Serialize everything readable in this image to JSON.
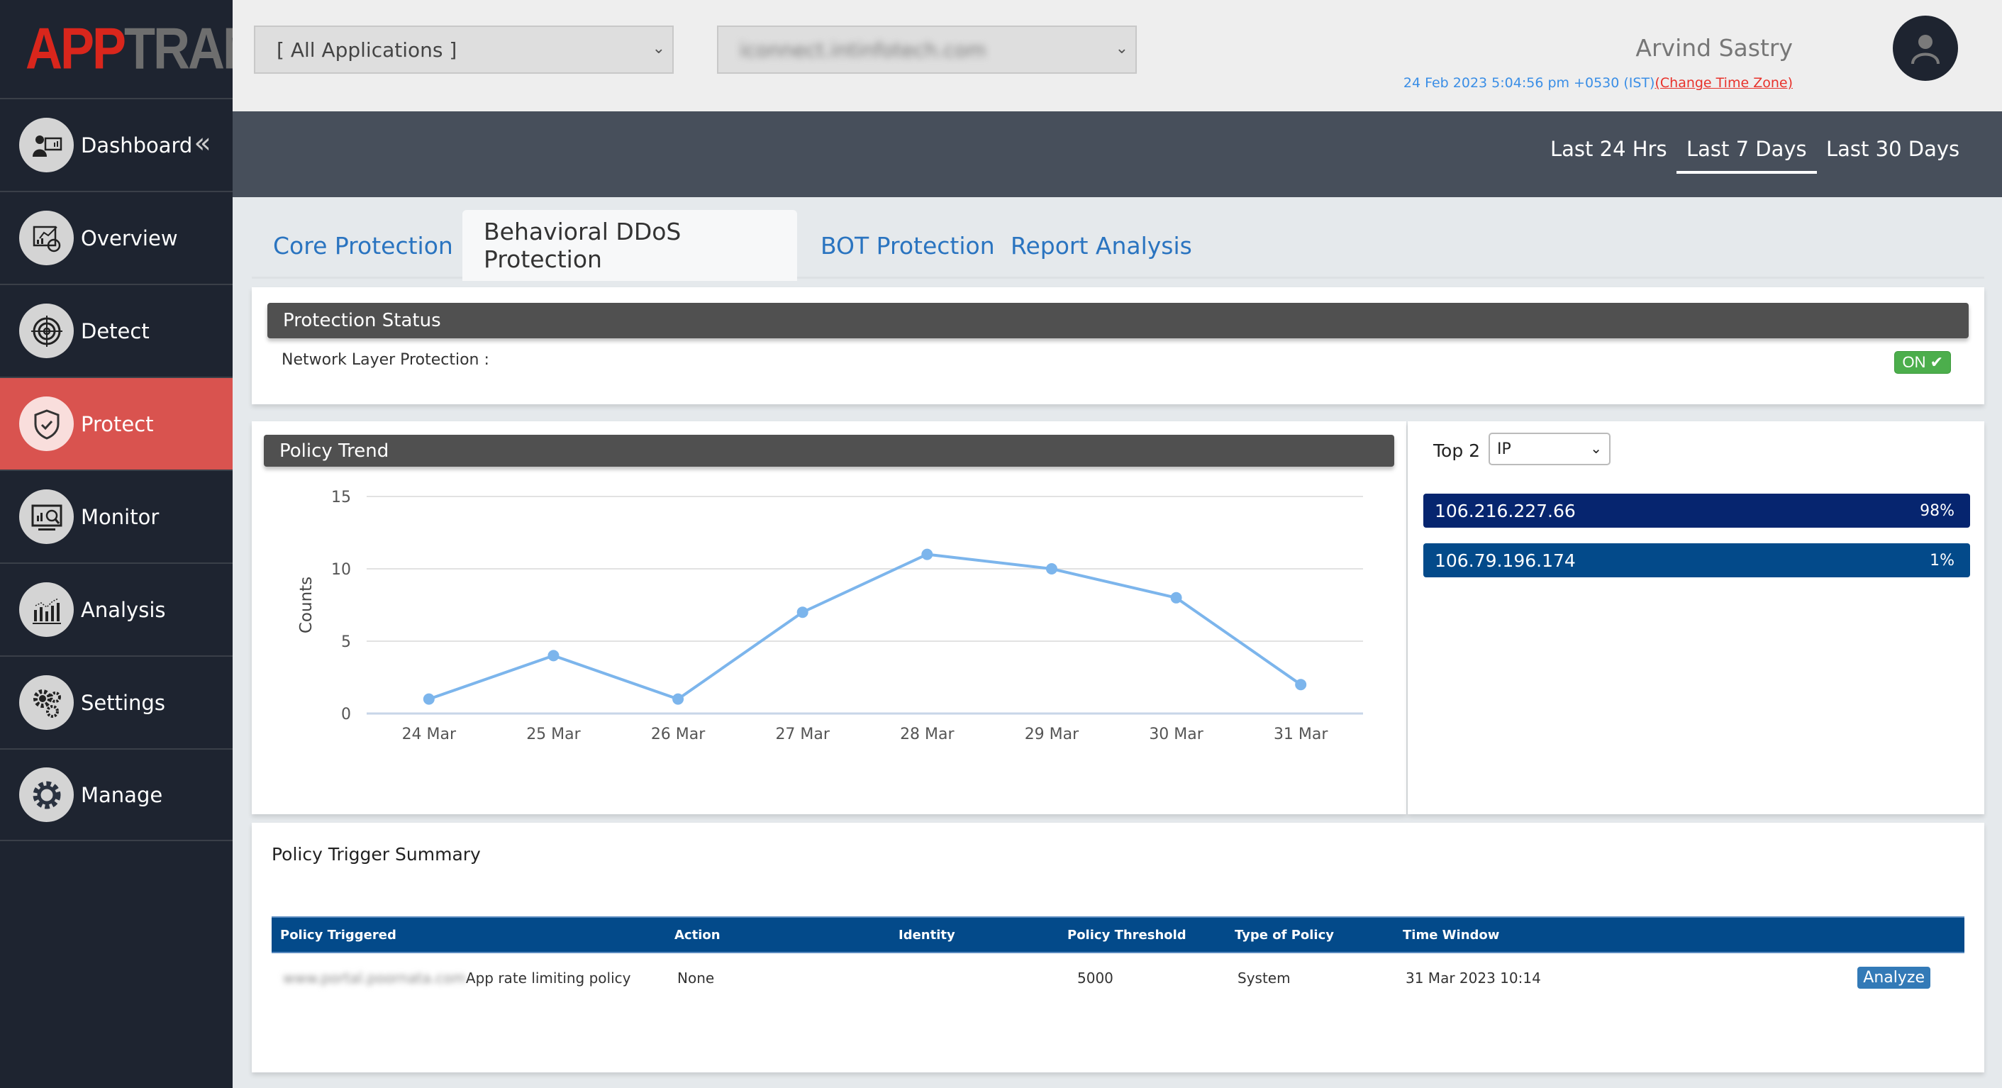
{
  "brand": {
    "part1": "APP",
    "part2": "TRANA"
  },
  "sidebar": {
    "collapse_icon": "«",
    "items": [
      {
        "label": "Dashboard",
        "icon": "dashboard-icon"
      },
      {
        "label": "Overview",
        "icon": "overview-icon"
      },
      {
        "label": "Detect",
        "icon": "target-icon"
      },
      {
        "label": "Protect",
        "icon": "shield-check-icon",
        "active": true
      },
      {
        "label": "Monitor",
        "icon": "monitor-icon"
      },
      {
        "label": "Analysis",
        "icon": "analysis-icon"
      },
      {
        "label": "Settings",
        "icon": "gears-icon"
      },
      {
        "label": "Manage",
        "icon": "gear-icon"
      }
    ]
  },
  "header": {
    "app_select": "[ All Applications ]",
    "domain_select": "iconnect.intinfotech.com",
    "user_name": "Arvind Sastry",
    "datetime": "24 Feb 2023 5:04:56 pm +0530 (IST)",
    "change_tz": "(Change Time Zone)"
  },
  "ranges": [
    "Last 24 Hrs",
    "Last 7 Days",
    "Last 30 Days"
  ],
  "active_range": "Last 7 Days",
  "tabs": [
    "Core Protection",
    "Behavioral DDoS Protection",
    "BOT Protection",
    "Report Analysis"
  ],
  "active_tab": "Behavioral DDoS Protection",
  "protection": {
    "title": "Protection Status",
    "label": "Network Layer Protection :",
    "status": "ON ✔"
  },
  "trend": {
    "title": "Policy Trend"
  },
  "top": {
    "label": "Top 2",
    "select": "IP",
    "items": [
      {
        "ip": "106.216.227.66",
        "pct": "98%",
        "color": "#06256f"
      },
      {
        "ip": "106.79.196.174",
        "pct": "1%",
        "color": "#034a8a"
      }
    ]
  },
  "summary": {
    "title": "Policy Trigger Summary",
    "columns": [
      "Policy Triggered",
      "Action",
      "Identity",
      "Policy Threshold",
      "Type of Policy",
      "Time Window",
      ""
    ],
    "rows": [
      {
        "domain": "www.portal.poornata.com",
        "policy": "App rate limiting policy",
        "action": "None",
        "identity": "",
        "threshold": "5000",
        "type": "System",
        "time": "31 Mar 2023 10:14",
        "button": "Analyze"
      }
    ]
  },
  "chart_data": {
    "type": "line",
    "title": "Policy Trend",
    "xlabel": "",
    "ylabel": "Counts",
    "categories": [
      "24 Mar",
      "25 Mar",
      "26 Mar",
      "27 Mar",
      "28 Mar",
      "29 Mar",
      "30 Mar",
      "31 Mar"
    ],
    "series": [
      {
        "name": "Counts",
        "values": [
          1,
          4,
          1,
          7,
          11,
          10,
          8,
          2
        ],
        "color": "#7cb5ec"
      }
    ],
    "ylim": [
      0,
      15
    ],
    "yticks": [
      0,
      5,
      10,
      15
    ],
    "grid": true
  }
}
